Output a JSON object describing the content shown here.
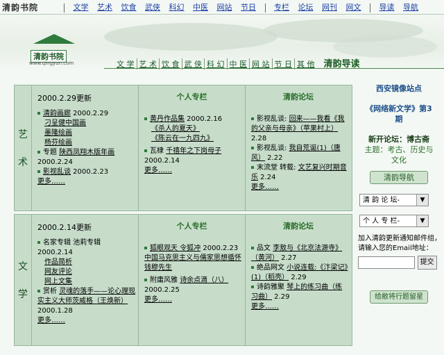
{
  "topnav": {
    "brand": "清韵书院",
    "group1": [
      "文学",
      "艺术",
      "饮食",
      "武侠",
      "科幻",
      "中医",
      "网站",
      "节日"
    ],
    "group2": [
      "专栏",
      "论坛",
      "网刊",
      "网文"
    ],
    "group3": [
      "导读",
      "导航"
    ]
  },
  "banner": {
    "logo_name": "清韵书院",
    "logo_url": "www.qingyun.com",
    "nav": [
      "文 学",
      "艺 术",
      "饮 食",
      "武 侠",
      "科 幻",
      "中 医",
      "网 站",
      "节 日",
      "其 他"
    ],
    "guide": "清韵导读"
  },
  "art": {
    "side_label_1": "艺",
    "side_label_2": "术",
    "col1": {
      "date": "2000.2.29更新",
      "items": [
        {
          "link": "清韵画廊",
          "after": " 2000.2.29"
        },
        {
          "sub": "刁呈健中国画"
        },
        {
          "sub": "墨隆绘画"
        },
        {
          "sub": "杨芬绘画"
        },
        {
          "pre": "专题 ",
          "link": "陕西凤翔木版年画"
        },
        {
          "plain": "2000.2.24"
        },
        {
          "link": "影视乱谈",
          "after": " 2000.2.23"
        }
      ],
      "more": "更多……"
    },
    "col2": {
      "header": "个人专栏",
      "items": [
        {
          "link": "黄丹作品集",
          "after": " 2000.2.16"
        },
        {
          "sub": "《杀人的夏天》"
        },
        {
          "sub": "《陈云在一九四九》"
        },
        {
          "pre": "瓦棣 ",
          "link": "千禧年之下岗母子"
        },
        {
          "plain": "2000.2.14"
        }
      ],
      "more": "更多……"
    },
    "col3": {
      "header": "清韵论坛",
      "items": [
        {
          "pre": "影视乱谈: ",
          "link": "回来——我看《我的父亲与母亲》（苹果村上）",
          "after": " 2.28"
        },
        {
          "pre": "影视乱谈: ",
          "link": "我自荒诞(1)（唐风）",
          "after": " 2.22"
        },
        {
          "pre": "末流堂 转载: ",
          "link": "文艺复兴时期音乐",
          "after": " 2.24"
        }
      ],
      "more": "更多……"
    }
  },
  "lit": {
    "side_label_1": "文",
    "side_label_2": "学",
    "col1": {
      "date": "2000.2.14更新",
      "items": [
        {
          "plain": "名家专辑 池莉专辑"
        },
        {
          "plain": "2000.2.14"
        },
        {
          "sub": "作品简析"
        },
        {
          "sub": "网友评论"
        },
        {
          "sub": "网上文集"
        },
        {
          "pre": "赏析 ",
          "link": "灵魂的落手——论心理现实主义大师茨威格（王焕新）",
          "after": " 2000.1.28"
        }
      ],
      "more": "更多……"
    },
    "col2": {
      "header": "个人专栏",
      "items": [
        {
          "link": "狐眼观天 令狐冲",
          "after": " 2000.2.23"
        },
        {
          "link": "中国马克思主义与儒家思想循怀钱穆先生"
        },
        {
          "pre": "附庸风雅 ",
          "link": "诗余点滴（八）"
        },
        {
          "plain": "2000.2.25"
        }
      ],
      "more": "更多……"
    },
    "col3": {
      "header": "清韵论坛",
      "items": [
        {
          "pre": "品文 ",
          "link": "李敖与《北京法源寺》（黄河）",
          "after": " 2.27"
        },
        {
          "pre": "绝品网文 ",
          "link": "小说连载:《汴梁记》(1)（稻壳）",
          "after": " 2.29"
        },
        {
          "pre": "诗韵雅聚 ",
          "link": "琴上的练习曲（练习曲）",
          "after": " 2.29"
        }
      ],
      "more": "更多……"
    }
  },
  "right": {
    "site_link": "西安镜像站点",
    "mag_line1": "《网络新文学》第3",
    "mag_line2": "期",
    "forum_title": "新开论坛：博古斋",
    "forum_topic_1": "主题：考古、历史与",
    "forum_topic_2": "文化",
    "nav_btn": "清韵导航",
    "select1": "清 韵 论 坛-",
    "select2": "个 人 专 栏-",
    "email_text": "加入清韵更新通知邮件组，请输入您的Email地址：",
    "submit": "提交",
    "msg_btn": "给敝将行题留星"
  }
}
